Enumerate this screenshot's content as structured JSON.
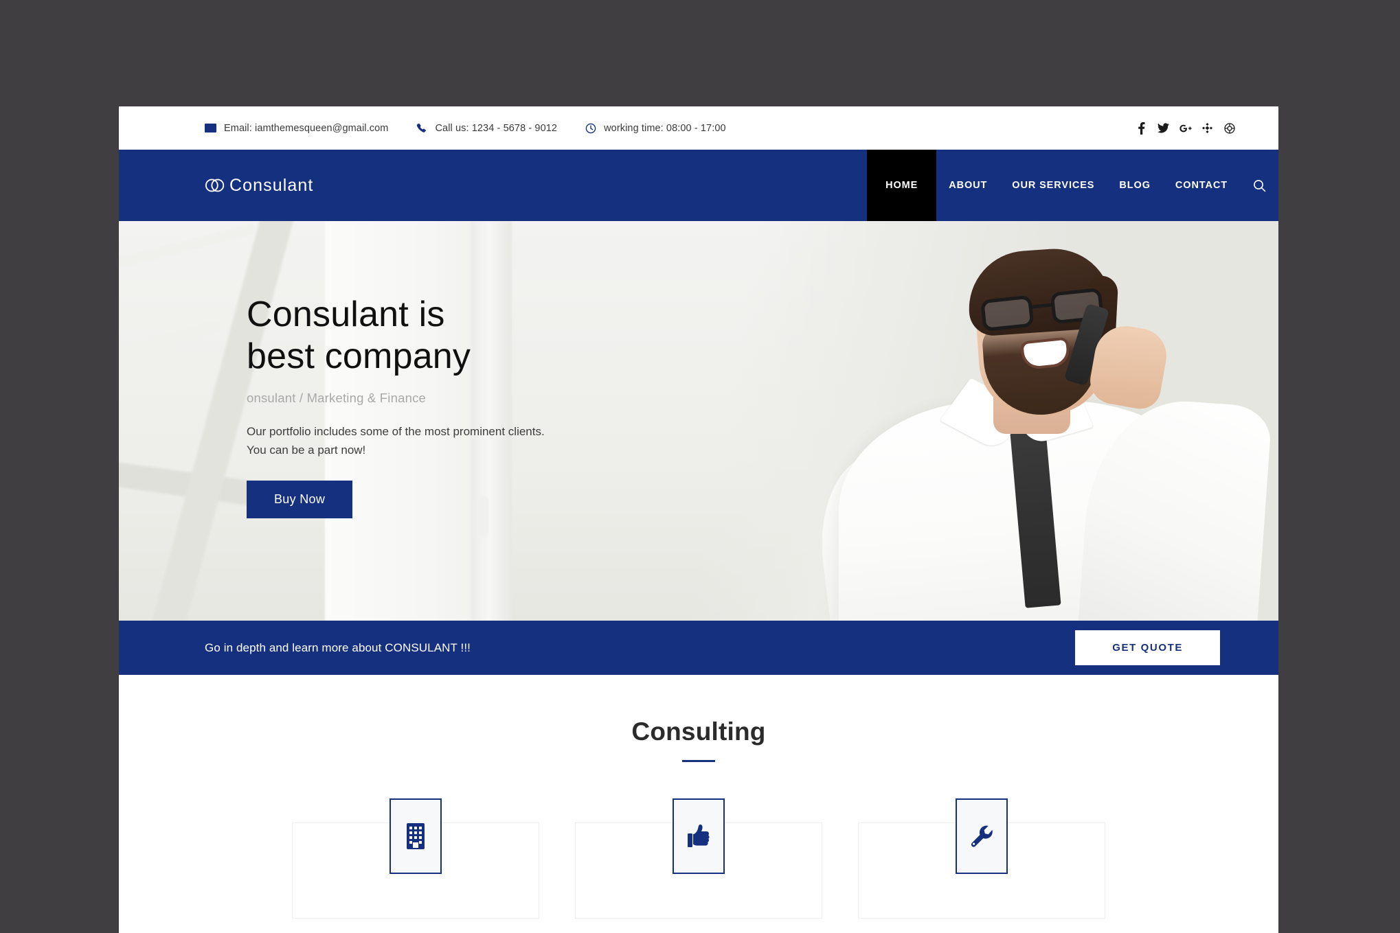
{
  "topbar": {
    "email": "Email: iamthemesqueen@gmail.com",
    "phone": "Call us: 1234 - 5678 - 9012",
    "hours": "working time: 08:00 - 17:00",
    "socials": [
      {
        "name": "facebook-icon",
        "glyph": "f"
      },
      {
        "name": "twitter-icon",
        "glyph": "t"
      },
      {
        "name": "google-plus-icon",
        "glyph": "g+"
      },
      {
        "name": "joomla-icon",
        "glyph": "j"
      },
      {
        "name": "dribbble-icon",
        "glyph": "d"
      }
    ]
  },
  "header": {
    "logo_text": "Consulant",
    "nav": [
      {
        "label": "HOME",
        "active": true
      },
      {
        "label": "ABOUT",
        "active": false
      },
      {
        "label": "OUR SERVICES",
        "active": false
      },
      {
        "label": "BLOG",
        "active": false
      },
      {
        "label": "CONTACT",
        "active": false
      }
    ],
    "search_label": "Search"
  },
  "hero": {
    "title_line1": "Consulant is",
    "title_line2": "best company",
    "subtitle": "onsulant / Marketing & Finance",
    "paragraph_line1": "Our portfolio includes some of the most prominent clients.",
    "paragraph_line2": "You can be a part now!",
    "button": "Buy Now"
  },
  "cta": {
    "text": "Go in depth and learn more about CONSULANT !!!",
    "button": "GET QUOTE"
  },
  "consulting": {
    "title": "Consulting",
    "cards": [
      {
        "icon": "building-icon"
      },
      {
        "icon": "thumbs-up-icon"
      },
      {
        "icon": "wrench-icon"
      }
    ]
  },
  "colors": {
    "brand_navy": "#15307E",
    "active_tab": "#000000",
    "page_background": "#ffffff",
    "outer_background": "#403E41"
  }
}
